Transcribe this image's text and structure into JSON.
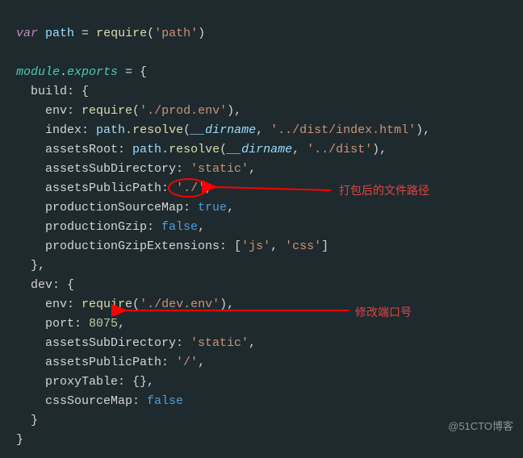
{
  "line1": {
    "var": "var",
    "path": "path",
    "eq": " = ",
    "require": "require",
    "lp": "(",
    "str": "'path'",
    "rp": ")"
  },
  "line3": {
    "module": "module",
    "dot": ".",
    "exports": "exports",
    "eq": " = {",
    "end": ""
  },
  "build": {
    "key": "build: {",
    "env": {
      "k": "env: ",
      "fn": "require",
      "lp": "(",
      "s": "'./prod.env'",
      "rp": "),"
    },
    "index": {
      "k": "index: ",
      "obj": "path",
      "dot": ".",
      "fn": "resolve",
      "lp": "(",
      "p1": "__dirname",
      "c": ", ",
      "s": "'../dist/index.html'",
      "rp": "),"
    },
    "assetsRoot": {
      "k": "assetsRoot: ",
      "obj": "path",
      "dot": ".",
      "fn": "resolve",
      "lp": "(",
      "p1": "__dirname",
      "c": ", ",
      "s": "'../dist'",
      "rp": "),"
    },
    "assetsSubDirectory": {
      "k": "assetsSubDirectory: ",
      "s": "'static'",
      "c": ","
    },
    "assetsPublicPath": {
      "k": "assetsPublicPath:",
      "sp": " ",
      "s": "'./'",
      "c": ","
    },
    "productionSourceMap": {
      "k": "productionSourceMap: ",
      "v": "true",
      "c": ","
    },
    "productionGzip": {
      "k": "productionGzip: ",
      "v": "false",
      "c": ","
    },
    "productionGzipExtensions": {
      "k": "productionGzipExtensions: [",
      "s1": "'js'",
      "c": ", ",
      "s2": "'css'",
      "rb": "]"
    },
    "close": "},"
  },
  "dev": {
    "key": "dev: {",
    "env": {
      "k": "env: ",
      "fn": "require",
      "lp": "(",
      "s": "'./dev.env'",
      "rp": "),"
    },
    "port": {
      "k": "port: ",
      "v": "8075",
      "c": ","
    },
    "assetsSubDirectory": {
      "k": "assetsSubDirectory: ",
      "s": "'static'",
      "c": ","
    },
    "assetsPublicPath": {
      "k": "assetsPublicPath: ",
      "s": "'/'",
      "c": ","
    },
    "proxyTable": {
      "k": "proxyTable: {},"
    },
    "cssSourceMap": {
      "k": "cssSourceMap: ",
      "v": "false"
    },
    "close": "}"
  },
  "close": "}",
  "annotations": {
    "a1": "打包后的文件路径",
    "a2": "修改端口号"
  },
  "watermark": "@51CTO博客"
}
